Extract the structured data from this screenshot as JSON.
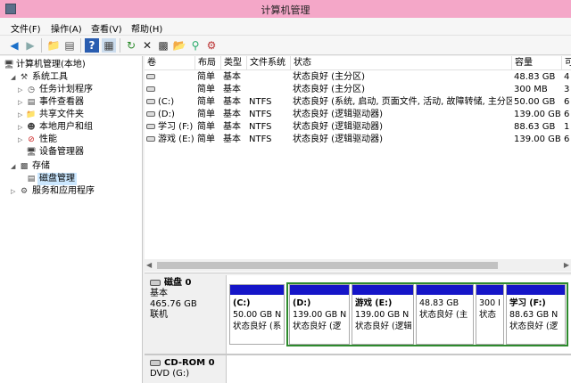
{
  "window": {
    "title": "计算机管理"
  },
  "menu": [
    "文件(F)",
    "操作(A)",
    "查看(V)",
    "帮助(H)"
  ],
  "tree": {
    "root": "计算机管理(本地)",
    "system_tools": "系统工具",
    "task_scheduler": "任务计划程序",
    "event_viewer": "事件查看器",
    "shared_folders": "共享文件夹",
    "local_users": "本地用户和组",
    "performance": "性能",
    "device_manager": "设备管理器",
    "storage": "存储",
    "disk_management": "磁盘管理",
    "services_apps": "服务和应用程序"
  },
  "list": {
    "headers": [
      "卷",
      "布局",
      "类型",
      "文件系统",
      "状态",
      "容量",
      "可"
    ],
    "rows": [
      [
        "",
        "简单",
        "基本",
        "",
        "状态良好 (主分区)",
        "48.83 GB",
        "4"
      ],
      [
        "",
        "简单",
        "基本",
        "",
        "状态良好 (主分区)",
        "300 MB",
        "3"
      ],
      [
        "(C:)",
        "简单",
        "基本",
        "NTFS",
        "状态良好 (系统, 启动, 页面文件, 活动, 故障转储, 主分区)",
        "50.00 GB",
        "6"
      ],
      [
        "(D:)",
        "简单",
        "基本",
        "NTFS",
        "状态良好 (逻辑驱动器)",
        "139.00 GB",
        "6"
      ],
      [
        "学习 (F:)",
        "简单",
        "基本",
        "NTFS",
        "状态良好 (逻辑驱动器)",
        "88.63 GB",
        "1"
      ],
      [
        "游戏 (E:)",
        "简单",
        "基本",
        "NTFS",
        "状态良好 (逻辑驱动器)",
        "139.00 GB",
        "6"
      ]
    ]
  },
  "disk0": {
    "name": "磁盘 0",
    "type": "基本",
    "size": "465.76 GB",
    "status": "联机",
    "partitions": [
      {
        "name": "(C:)",
        "size": "50.00 GB N",
        "status": "状态良好 (系"
      },
      {
        "name": "(D:)",
        "size": "139.00 GB N",
        "status": "状态良好 (逻"
      },
      {
        "name": "游戏 (E:)",
        "size": "139.00 GB N",
        "status": "状态良好 (逻辑"
      },
      {
        "name": "",
        "size": "48.83 GB",
        "status": "状态良好 (主"
      },
      {
        "name": "",
        "size": "300 I",
        "status": "状态"
      },
      {
        "name": "学习 (F:)",
        "size": "88.63 GB N",
        "status": "状态良好 (逻"
      }
    ]
  },
  "cdrom0": {
    "name": "CD-ROM 0",
    "drive": "DVD (G:)"
  },
  "colors": {
    "titlebar": "#f4a7c8",
    "partition_bar": "#1515c8",
    "extended_border": "#2e8b2e"
  }
}
